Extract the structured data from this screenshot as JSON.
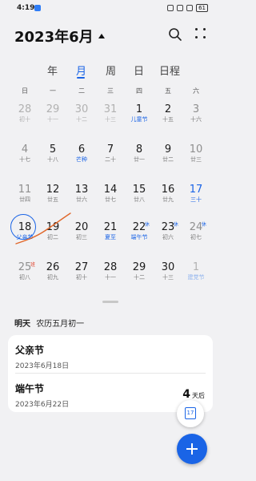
{
  "status": {
    "time": "4:19",
    "battery": "61"
  },
  "header": {
    "month": "2023年6月"
  },
  "tabs": [
    {
      "label": "年",
      "active": false
    },
    {
      "label": "月",
      "active": true
    },
    {
      "label": "周",
      "active": false
    },
    {
      "label": "日",
      "active": false
    },
    {
      "label": "日程",
      "active": false
    }
  ],
  "weekdays": [
    "日",
    "一",
    "二",
    "三",
    "四",
    "五",
    "六"
  ],
  "weeks": [
    [
      {
        "day": "28",
        "lunar": "初十",
        "other": true
      },
      {
        "day": "29",
        "lunar": "十一",
        "other": true
      },
      {
        "day": "30",
        "lunar": "十二",
        "other": true
      },
      {
        "day": "31",
        "lunar": "十三",
        "other": true
      },
      {
        "day": "1",
        "lunar": "儿童节",
        "lunar_hl": true
      },
      {
        "day": "2",
        "lunar": "十五"
      },
      {
        "day": "3",
        "lunar": "十六",
        "weekend": true
      }
    ],
    [
      {
        "day": "4",
        "lunar": "十七",
        "weekend": true
      },
      {
        "day": "5",
        "lunar": "十八"
      },
      {
        "day": "6",
        "lunar": "芒种",
        "lunar_hl": true
      },
      {
        "day": "7",
        "lunar": "二十"
      },
      {
        "day": "8",
        "lunar": "廿一"
      },
      {
        "day": "9",
        "lunar": "廿二"
      },
      {
        "day": "10",
        "lunar": "廿三",
        "weekend": true
      }
    ],
    [
      {
        "day": "11",
        "lunar": "廿四",
        "weekend": true
      },
      {
        "day": "12",
        "lunar": "廿五"
      },
      {
        "day": "13",
        "lunar": "廿六"
      },
      {
        "day": "14",
        "lunar": "廿七"
      },
      {
        "day": "15",
        "lunar": "廿八"
      },
      {
        "day": "16",
        "lunar": "廿九"
      },
      {
        "day": "17",
        "lunar": "三十",
        "blue": true
      }
    ],
    [
      {
        "day": "18",
        "lunar": "父亲节",
        "selected": true,
        "lunar_hl": true
      },
      {
        "day": "19",
        "lunar": "初二"
      },
      {
        "day": "20",
        "lunar": "初三"
      },
      {
        "day": "21",
        "lunar": "夏至",
        "lunar_hl": true
      },
      {
        "day": "22",
        "lunar": "端午节",
        "badge": "休",
        "lunar_hl": true
      },
      {
        "day": "23",
        "lunar": "初六",
        "badge": "休"
      },
      {
        "day": "24",
        "lunar": "初七",
        "badge": "休",
        "weekend": true
      }
    ],
    [
      {
        "day": "25",
        "lunar": "初八",
        "badge": "班",
        "badge_red": true,
        "weekend": true
      },
      {
        "day": "26",
        "lunar": "初九"
      },
      {
        "day": "27",
        "lunar": "初十"
      },
      {
        "day": "28",
        "lunar": "十一"
      },
      {
        "day": "29",
        "lunar": "十二"
      },
      {
        "day": "30",
        "lunar": "十三"
      },
      {
        "day": "1",
        "lunar": "建党节",
        "other": true,
        "lunar_hl_light": true
      }
    ]
  ],
  "subheader": {
    "label": "明天",
    "lunar": "农历五月初一"
  },
  "events": [
    {
      "name": "父亲节",
      "date": "2023年6月18日"
    },
    {
      "name": "端午节",
      "date": "2023年6月22日"
    }
  ],
  "countdown": {
    "value": "4",
    "unit": "天后"
  },
  "today_button": {
    "day": "17"
  },
  "colors": {
    "accent": "#1a64e6",
    "background": "#f1f1f3",
    "holiday_badge": "#1a64e6",
    "work_badge": "#e0452e"
  }
}
